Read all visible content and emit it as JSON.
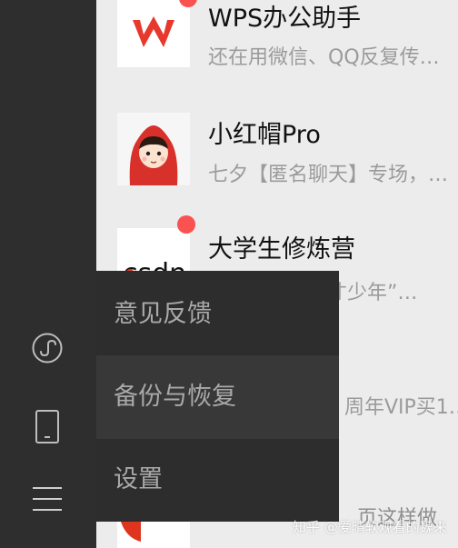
{
  "sidebar": {
    "icons": [
      "mini-program-icon",
      "phone-icon",
      "menu-icon"
    ]
  },
  "chats": [
    {
      "title": "WPS办公助手",
      "preview": "还在用微信、QQ反复传…",
      "avatar": "wps-logo",
      "unread": true
    },
    {
      "title": "小红帽Pro",
      "preview": "七夕【匿名聊天】专场，…",
      "avatar": "red-hood-avatar",
      "unread": false
    },
    {
      "title": "大学生修炼营",
      "preview": "天才少年”…",
      "avatar": "csdn-logo",
      "unread": true
    },
    {
      "title": "",
      "preview": "周年VIP买1…",
      "avatar": "",
      "unread": false
    },
    {
      "title": "",
      "preview": "页这样做",
      "avatar": "",
      "unread": false
    }
  ],
  "menu": {
    "items": [
      {
        "label": "意见反馈",
        "hovered": false
      },
      {
        "label": "备份与恢复",
        "hovered": true
      },
      {
        "label": "设置",
        "hovered": false
      }
    ]
  },
  "watermark": "知乎 @爱晴软观看的魏来",
  "colors": {
    "sidebar": "#2e2e2e",
    "list_bg": "#ececec",
    "menu_bg": "#2d2d2d",
    "menu_hover": "#383838",
    "badge": "#fa5151",
    "wps_red": "#e8382c",
    "csdn_red": "#e1341e"
  },
  "avatar_text": {
    "csdn": "csdn"
  }
}
